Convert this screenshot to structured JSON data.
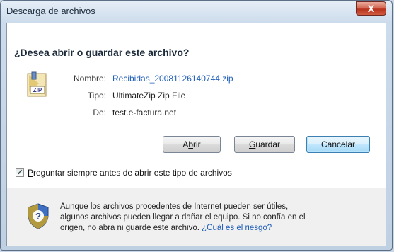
{
  "window": {
    "title": "Descarga de archivos",
    "close_label": "X"
  },
  "dialog": {
    "question": "¿Desea abrir o guardar este archivo?",
    "fields": [
      {
        "label": "Nombre:",
        "value": "Recibidas_20081126140744.zip"
      },
      {
        "label": "Tipo:",
        "value": "UltimateZip Zip File"
      },
      {
        "label": "De:",
        "value": "test.e-factura.net"
      }
    ],
    "buttons": {
      "open_pre": "A",
      "open_key": "b",
      "open_post": "rir",
      "save_key": "G",
      "save_post": "uardar",
      "cancel": "Cancelar"
    },
    "checkbox": {
      "checked": true,
      "mark": "✓",
      "key": "P",
      "label_post": "reguntar siempre antes de abrir este tipo de archivos"
    },
    "warning": {
      "text": "Aunque los archivos procedentes de Internet pueden ser útiles, algunos archivos pueden llegar a dañar el equipo. Si no confía en el origen, no abra ni guarde este archivo.",
      "link": "¿Cuál es el riesgo?"
    }
  },
  "icons": {
    "file": "zip-file-icon",
    "shield": "security-shield-icon"
  },
  "colors": {
    "link": "#1f5eb8",
    "default_button_border": "#3c7fb1",
    "close_button": "#c4442c"
  }
}
